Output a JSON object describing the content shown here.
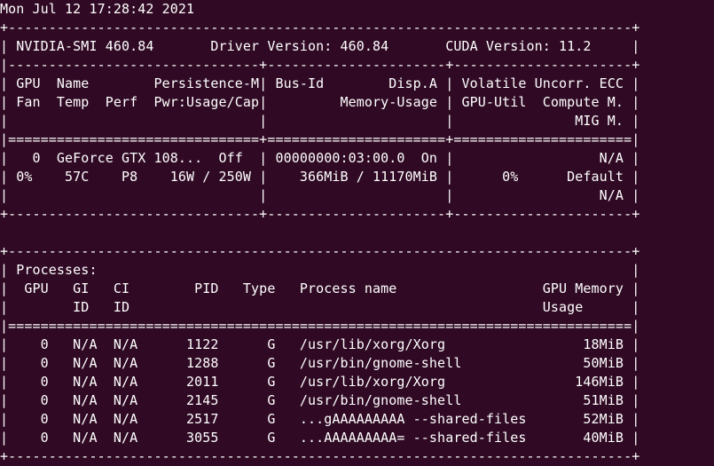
{
  "window": {
    "background": "#300a24",
    "foreground": "#ffffff"
  },
  "terminal": {
    "lines": [
      "Mon Jul 12 17:28:42 2021",
      "+-----------------------------------------------------------------------------+",
      "| NVIDIA-SMI 460.84       Driver Version: 460.84       CUDA Version: 11.2     |",
      "|-------------------------------+----------------------+----------------------+",
      "| GPU  Name        Persistence-M| Bus-Id        Disp.A | Volatile Uncorr. ECC |",
      "| Fan  Temp  Perf  Pwr:Usage/Cap|         Memory-Usage | GPU-Util  Compute M. |",
      "|                               |                      |               MIG M. |",
      "|===============================+======================+======================|",
      "|   0  GeForce GTX 108...  Off  | 00000000:03:00.0  On |                  N/A |",
      "| 0%    57C    P8    16W / 250W |    366MiB / 11170MiB |      0%      Default |",
      "|                               |                      |                  N/A |",
      "+-------------------------------+----------------------+----------------------+",
      "",
      "+-----------------------------------------------------------------------------+",
      "| Processes:                                                                  |",
      "|  GPU   GI   CI        PID   Type   Process name                  GPU Memory |",
      "|        ID   ID                                                   Usage      |",
      "|=============================================================================|",
      "|    0   N/A  N/A      1122      G   /usr/lib/xorg/Xorg                 18MiB |",
      "|    0   N/A  N/A      1288      G   /usr/bin/gnome-shell               50MiB |",
      "|    0   N/A  N/A      2011      G   /usr/lib/xorg/Xorg                146MiB |",
      "|    0   N/A  N/A      2145      G   /usr/bin/gnome-shell               51MiB |",
      "|    0   N/A  N/A      2517      G   ...gAAAAAAAAA --shared-files       52MiB |",
      "|    0   N/A  N/A      3055      G   ...AAAAAAAAA= --shared-files       40MiB |",
      "+-----------------------------------------------------------------------------+"
    ]
  }
}
